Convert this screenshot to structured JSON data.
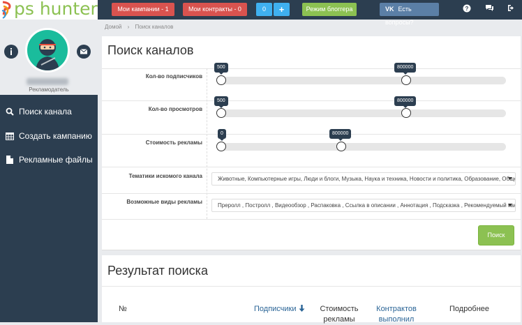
{
  "logo": {
    "text": "ps hunter"
  },
  "topbar": {
    "my_campaigns": "Мои кампании - 1",
    "my_contracts": "Мои контракты - 0",
    "counter": "0",
    "plus": "+",
    "blogger_mode": "Режим блоггера",
    "vk_icon": "vk-icon",
    "questions": "Есть вопросы?",
    "colors": {
      "red": "#d9534f",
      "blue": "#3fb0f0",
      "green": "#8cc152",
      "vk": "#5b7fa6"
    }
  },
  "sidebar": {
    "role": "Рекламодатель",
    "items": [
      {
        "label": "Поиск канала",
        "icon": "search-icon"
      },
      {
        "label": "Создать кампанию",
        "icon": "table-icon"
      },
      {
        "label": "Рекламные файлы",
        "icon": "file-icon"
      }
    ]
  },
  "breadcrumb": {
    "home": "Домой",
    "sep": "›",
    "current": "Поиск каналов"
  },
  "search": {
    "title": "Поиск каналов",
    "subscribers": {
      "label": "Кол-во подписчиков",
      "min": "500",
      "max": "800000",
      "min_pos": 0.0,
      "max_pos": 0.65
    },
    "views": {
      "label": "Кол-во просмотров",
      "min": "500",
      "max": "800000",
      "min_pos": 0.0,
      "max_pos": 0.65
    },
    "cost": {
      "label": "Стоимость рекламы",
      "min": "0",
      "max": "800000",
      "min_pos": 0.0,
      "max_pos": 0.42
    },
    "topics": {
      "label": "Тематики искомого канала",
      "value": "Животные, Компьютерные игры, Люди и блоги, Музыка, Наука и техника, Новости и политика, Образование, Общество"
    },
    "ad_types": {
      "label": "Возможные виды рекламы",
      "value": "Преролл , Постролл , Видеообзор , Распаковка , Ссылка в описании , Аннотация , Подсказка , Рекомендуемый канал"
    },
    "button": "Поиск"
  },
  "results": {
    "title": "Результат поиска",
    "columns": {
      "num": "№",
      "subscribers": "Подписчики",
      "cost_1": "Стоимость",
      "cost_2": "рекламы",
      "contracts_1": "Контрактов",
      "contracts_2": "выполнил",
      "details": "Подробнее"
    }
  }
}
